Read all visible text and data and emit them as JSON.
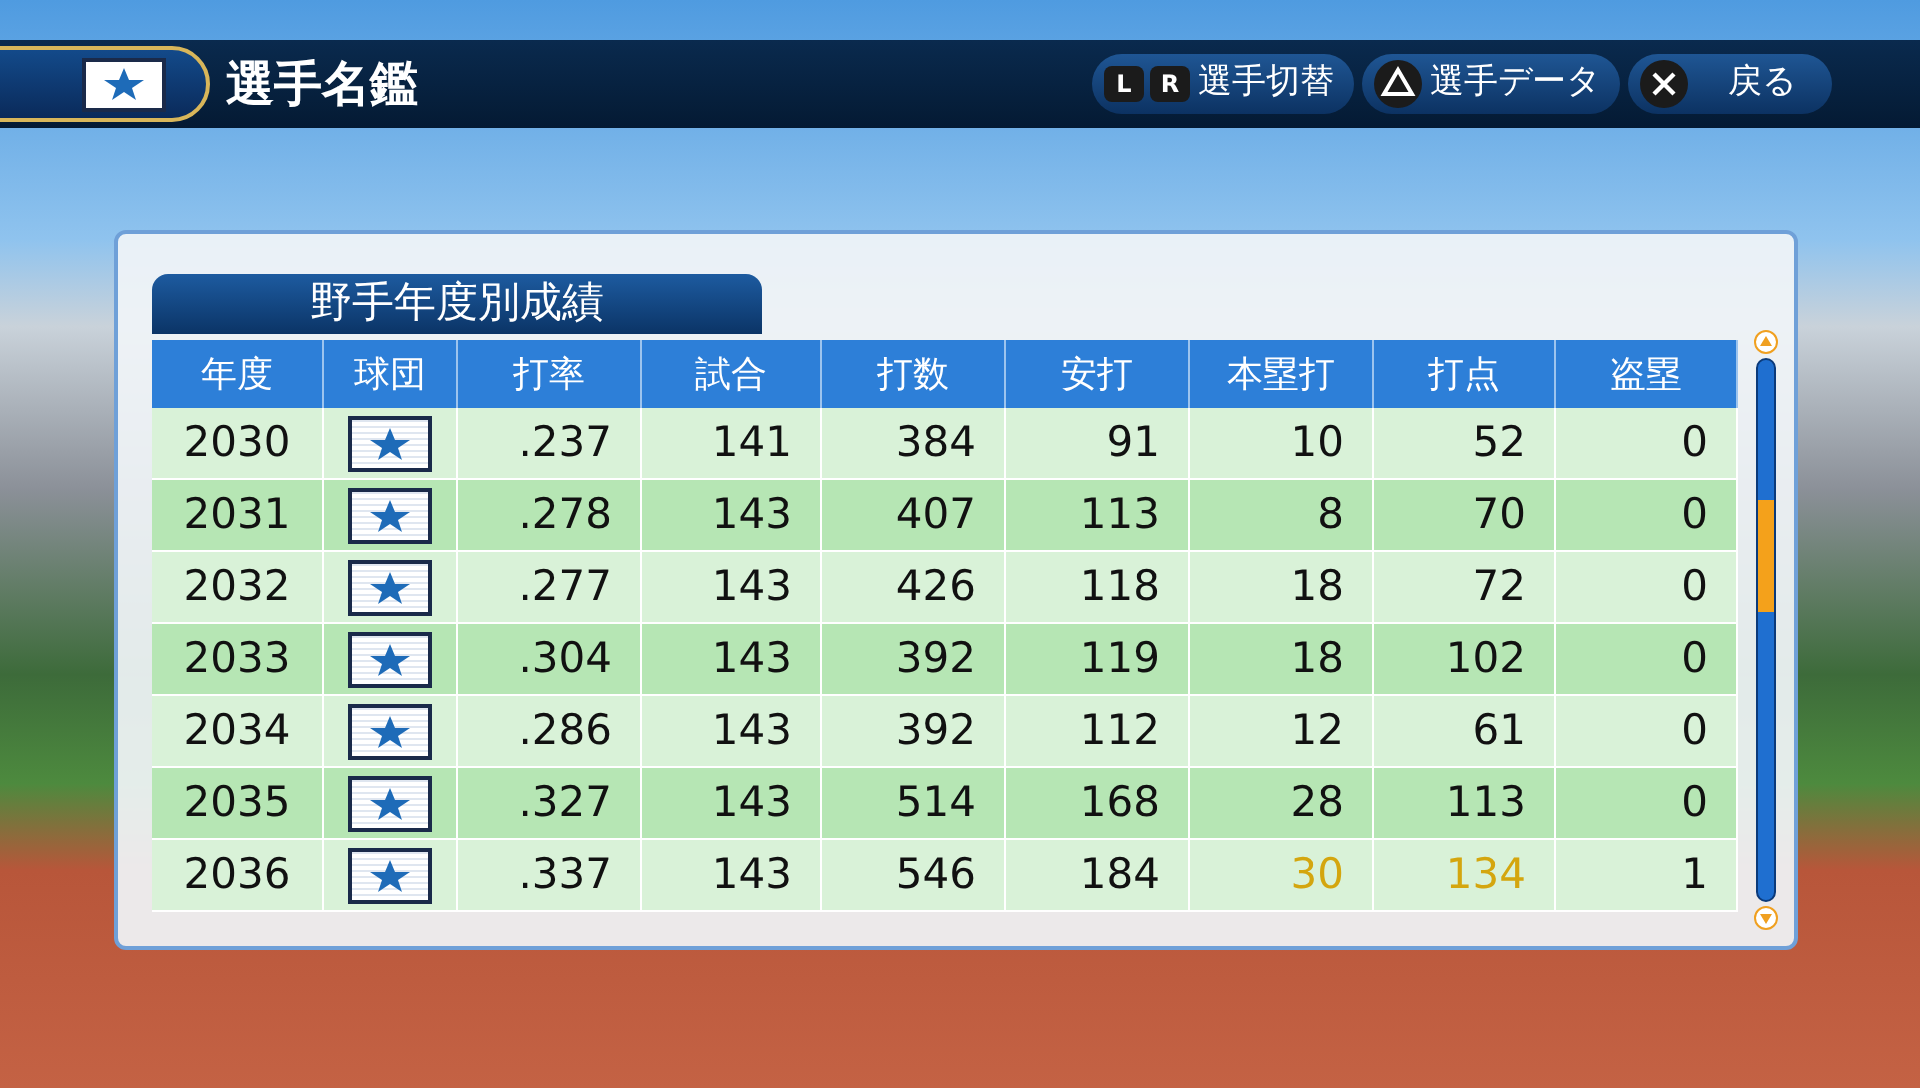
{
  "header": {
    "title": "選手名鑑",
    "buttons": [
      {
        "kind": "lr",
        "keys": [
          "L",
          "R"
        ],
        "label": "選手切替"
      },
      {
        "kind": "triangle",
        "label": "選手データ"
      },
      {
        "kind": "cross",
        "label": "戻る"
      }
    ]
  },
  "panel": {
    "title": "野手年度別成績"
  },
  "table": {
    "columns": [
      "年度",
      "球団",
      "打率",
      "試合",
      "打数",
      "安打",
      "本塁打",
      "打点",
      "盗塁"
    ],
    "rows": [
      {
        "cells": [
          {
            "kind": "year",
            "text": "2030"
          },
          {
            "kind": "logo"
          },
          {
            "kind": "stat",
            "text": ".237",
            "highlight": false
          },
          {
            "kind": "stat",
            "text": "141",
            "highlight": false
          },
          {
            "kind": "stat",
            "text": "384",
            "highlight": false
          },
          {
            "kind": "stat",
            "text": "91",
            "highlight": false
          },
          {
            "kind": "stat",
            "text": "10",
            "highlight": false
          },
          {
            "kind": "stat",
            "text": "52",
            "highlight": false
          },
          {
            "kind": "stat",
            "text": "0",
            "highlight": false
          }
        ]
      },
      {
        "cells": [
          {
            "kind": "year",
            "text": "2031"
          },
          {
            "kind": "logo"
          },
          {
            "kind": "stat",
            "text": ".278",
            "highlight": false
          },
          {
            "kind": "stat",
            "text": "143",
            "highlight": false
          },
          {
            "kind": "stat",
            "text": "407",
            "highlight": false
          },
          {
            "kind": "stat",
            "text": "113",
            "highlight": false
          },
          {
            "kind": "stat",
            "text": "8",
            "highlight": false
          },
          {
            "kind": "stat",
            "text": "70",
            "highlight": false
          },
          {
            "kind": "stat",
            "text": "0",
            "highlight": false
          }
        ]
      },
      {
        "cells": [
          {
            "kind": "year",
            "text": "2032"
          },
          {
            "kind": "logo"
          },
          {
            "kind": "stat",
            "text": ".277",
            "highlight": false
          },
          {
            "kind": "stat",
            "text": "143",
            "highlight": false
          },
          {
            "kind": "stat",
            "text": "426",
            "highlight": false
          },
          {
            "kind": "stat",
            "text": "118",
            "highlight": false
          },
          {
            "kind": "stat",
            "text": "18",
            "highlight": false
          },
          {
            "kind": "stat",
            "text": "72",
            "highlight": false
          },
          {
            "kind": "stat",
            "text": "0",
            "highlight": false
          }
        ]
      },
      {
        "cells": [
          {
            "kind": "year",
            "text": "2033"
          },
          {
            "kind": "logo"
          },
          {
            "kind": "stat",
            "text": ".304",
            "highlight": false
          },
          {
            "kind": "stat",
            "text": "143",
            "highlight": false
          },
          {
            "kind": "stat",
            "text": "392",
            "highlight": false
          },
          {
            "kind": "stat",
            "text": "119",
            "highlight": false
          },
          {
            "kind": "stat",
            "text": "18",
            "highlight": false
          },
          {
            "kind": "stat",
            "text": "102",
            "highlight": false
          },
          {
            "kind": "stat",
            "text": "0",
            "highlight": false
          }
        ]
      },
      {
        "cells": [
          {
            "kind": "year",
            "text": "2034"
          },
          {
            "kind": "logo"
          },
          {
            "kind": "stat",
            "text": ".286",
            "highlight": false
          },
          {
            "kind": "stat",
            "text": "143",
            "highlight": false
          },
          {
            "kind": "stat",
            "text": "392",
            "highlight": false
          },
          {
            "kind": "stat",
            "text": "112",
            "highlight": false
          },
          {
            "kind": "stat",
            "text": "12",
            "highlight": false
          },
          {
            "kind": "stat",
            "text": "61",
            "highlight": false
          },
          {
            "kind": "stat",
            "text": "0",
            "highlight": false
          }
        ]
      },
      {
        "cells": [
          {
            "kind": "year",
            "text": "2035"
          },
          {
            "kind": "logo"
          },
          {
            "kind": "stat",
            "text": ".327",
            "highlight": false
          },
          {
            "kind": "stat",
            "text": "143",
            "highlight": false
          },
          {
            "kind": "stat",
            "text": "514",
            "highlight": false
          },
          {
            "kind": "stat",
            "text": "168",
            "highlight": false
          },
          {
            "kind": "stat",
            "text": "28",
            "highlight": false
          },
          {
            "kind": "stat",
            "text": "113",
            "highlight": false
          },
          {
            "kind": "stat",
            "text": "0",
            "highlight": false
          }
        ]
      },
      {
        "cells": [
          {
            "kind": "year",
            "text": "2036"
          },
          {
            "kind": "logo"
          },
          {
            "kind": "stat",
            "text": ".337",
            "highlight": false
          },
          {
            "kind": "stat",
            "text": "143",
            "highlight": false
          },
          {
            "kind": "stat",
            "text": "546",
            "highlight": false
          },
          {
            "kind": "stat",
            "text": "184",
            "highlight": false
          },
          {
            "kind": "stat",
            "text": "30",
            "highlight": true
          },
          {
            "kind": "stat",
            "text": "134",
            "highlight": true
          },
          {
            "kind": "stat",
            "text": "1",
            "highlight": false
          }
        ]
      }
    ]
  }
}
